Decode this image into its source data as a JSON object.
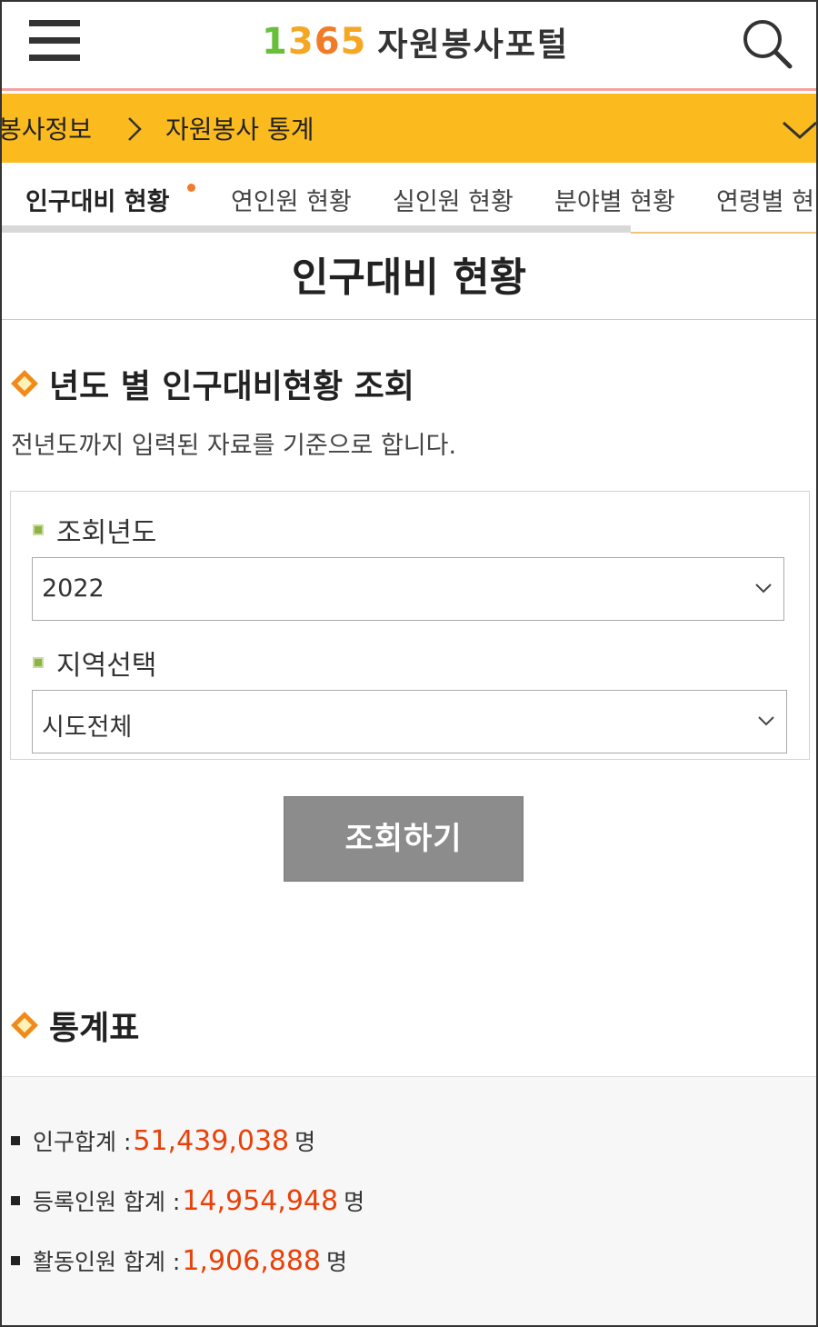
{
  "header": {
    "logo_number": "1365",
    "logo_text": "자원봉사포털"
  },
  "breadcrumb": {
    "parent": "봉사정보",
    "current": "자원봉사 통계"
  },
  "tabs": [
    {
      "label": "인구대비 현황",
      "active": true
    },
    {
      "label": "연인원 현황",
      "active": false
    },
    {
      "label": "실인원 현황",
      "active": false
    },
    {
      "label": "분야별 현황",
      "active": false
    },
    {
      "label": "연령별 현",
      "active": false
    }
  ],
  "page": {
    "title": "인구대비 현황"
  },
  "query_section": {
    "heading": "년도 별 인구대비현황 조회",
    "description": "전년도까지 입력된 자료를 기준으로 합니다.",
    "year_label": "조회년도",
    "year_value": "2022",
    "region_label": "지역선택",
    "region_value": "시도전체",
    "submit_label": "조회하기"
  },
  "stats_section": {
    "heading": "통계표",
    "rows": [
      {
        "label": "인구합계 :",
        "value": "51,439,038",
        "unit": "명"
      },
      {
        "label": "등록인원 합계 :",
        "value": "14,954,948",
        "unit": "명"
      },
      {
        "label": "활동인원 합계 :",
        "value": "1,906,888",
        "unit": "명"
      }
    ]
  },
  "colors": {
    "accent_yellow": "#fbbb1f",
    "value_orange": "#e8420a",
    "button_gray": "#8c8c8c"
  }
}
